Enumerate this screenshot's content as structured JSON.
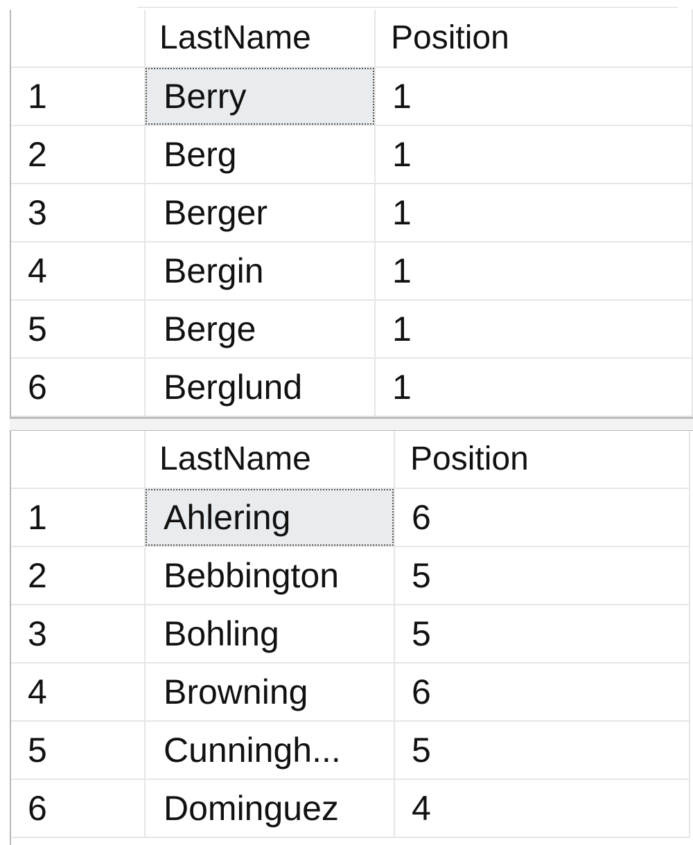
{
  "grids": [
    {
      "columns": [
        "LastName",
        "Position"
      ],
      "rows": [
        {
          "row": "1",
          "last_name": "Berry",
          "position": "1"
        },
        {
          "row": "2",
          "last_name": "Berg",
          "position": "1"
        },
        {
          "row": "3",
          "last_name": "Berger",
          "position": "1"
        },
        {
          "row": "4",
          "last_name": "Bergin",
          "position": "1"
        },
        {
          "row": "5",
          "last_name": "Berge",
          "position": "1"
        },
        {
          "row": "6",
          "last_name": "Berglund",
          "position": "1"
        }
      ],
      "selected_cell": "Berry"
    },
    {
      "columns": [
        "LastName",
        "Position"
      ],
      "rows": [
        {
          "row": "1",
          "last_name": "Ahlering",
          "position": "6"
        },
        {
          "row": "2",
          "last_name": "Bebbington",
          "position": "5"
        },
        {
          "row": "3",
          "last_name": "Bohling",
          "position": "5"
        },
        {
          "row": "4",
          "last_name": "Browning",
          "position": "6"
        },
        {
          "row": "5",
          "last_name": "Cunningh...",
          "position": "5"
        },
        {
          "row": "6",
          "last_name": "Dominguez",
          "position": "4"
        }
      ],
      "selected_cell": "Ahlering"
    }
  ],
  "colors": {
    "selected_cell_bg": "#e9ecee",
    "grid_line": "#e6e6e6"
  }
}
